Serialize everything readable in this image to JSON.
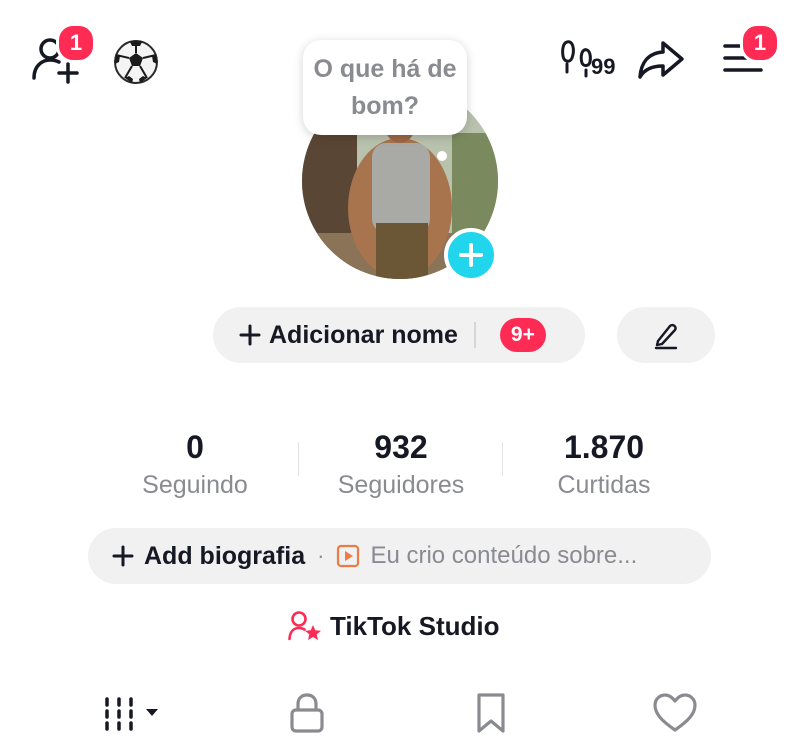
{
  "header": {
    "add_friends_badge": "1",
    "menu_badge": "1",
    "streak_count": "99"
  },
  "note_bubble": {
    "text": "O que há de bom?"
  },
  "profile": {
    "add_name_label": "Adicionar nome",
    "inbox_badge": "9+"
  },
  "stats": [
    {
      "value": "0",
      "label": "Seguindo"
    },
    {
      "value": "932",
      "label": "Seguidores"
    },
    {
      "value": "1.870",
      "label": "Curtidas"
    }
  ],
  "bio": {
    "add_label": "Add biografia",
    "separator": "·",
    "hint": "Eu crio conteúdo sobre..."
  },
  "studio": {
    "label": "TikTok Studio"
  },
  "colors": {
    "accent": "#fe2c55",
    "cyan": "#20d5ec",
    "pill_bg": "#f1f1f2",
    "muted_text": "#8a8b91",
    "orange": "#f07a44"
  },
  "icons": {
    "add_friends": "person-plus-icon",
    "soccer": "soccer-ball-icon",
    "streak": "footprints-icon",
    "share": "share-arrow-icon",
    "menu": "hamburger-menu-icon",
    "edit": "pencil-icon",
    "videos_tab": "grid-icon",
    "private_tab": "lock-icon",
    "saved_tab": "bookmark-icon",
    "liked_tab": "heart-icon"
  }
}
